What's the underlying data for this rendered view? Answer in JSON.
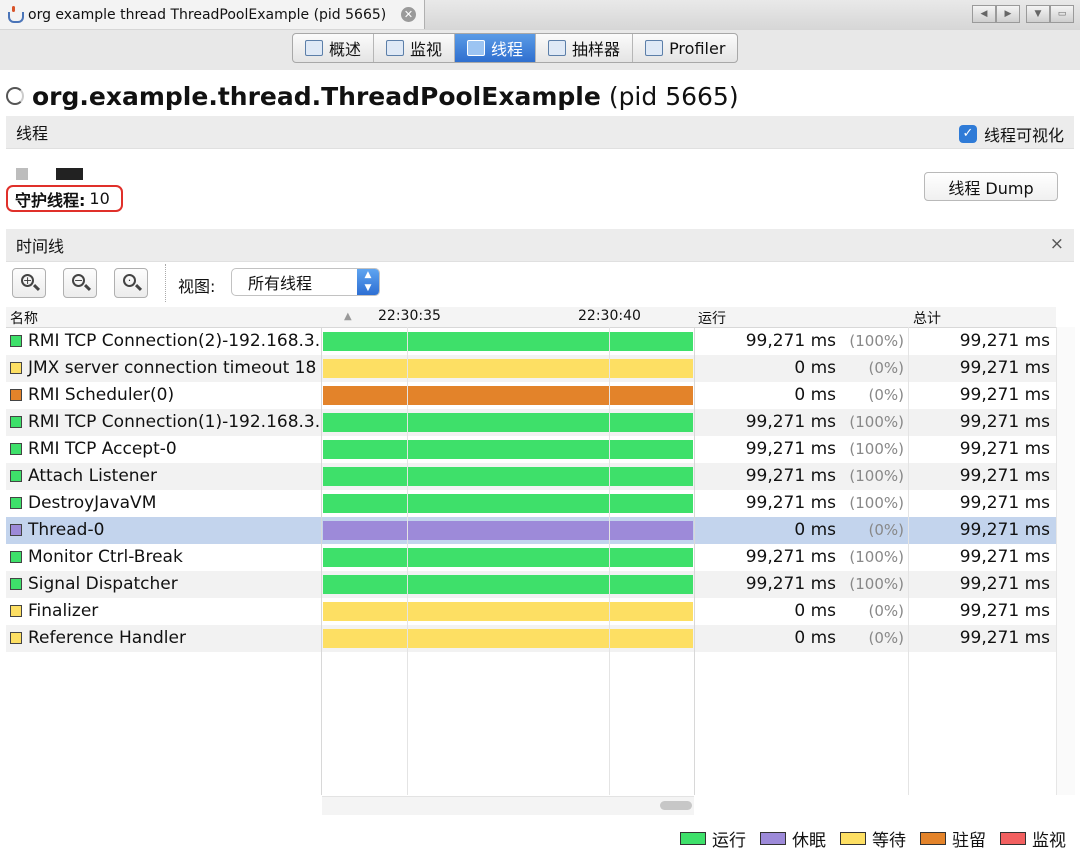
{
  "tab": {
    "title": "org example thread ThreadPoolExample (pid 5665)"
  },
  "views": [
    {
      "label": "概述",
      "icon": "overview-icon"
    },
    {
      "label": "监视",
      "icon": "monitor-icon"
    },
    {
      "label": "线程",
      "icon": "threads-icon",
      "active": true
    },
    {
      "label": "抽样器",
      "icon": "sampler-icon"
    },
    {
      "label": "Profiler",
      "icon": "profiler-icon"
    }
  ],
  "heading": {
    "name": "org.example.thread.ThreadPoolExample",
    "pid": "(pid 5665)"
  },
  "threads_section": {
    "label": "线程",
    "visualize_label": "线程可视化",
    "visualize_checked": true,
    "daemon_label": "守护线程:",
    "daemon_count": "10",
    "dump_button": "线程 Dump"
  },
  "timeline_section": {
    "label": "时间线",
    "close_symbol": "×"
  },
  "toolbar": {
    "view_label": "视图:",
    "view_value": "所有线程"
  },
  "table": {
    "headers": {
      "name": "名称",
      "run": "运行",
      "total": "总计"
    },
    "times": [
      "22:30:35",
      "22:30:40"
    ],
    "rows": [
      {
        "name": "RMI TCP Connection(2)-192.168.3.",
        "state": "running",
        "run": "99,271 ms",
        "pct": "(100%)",
        "total": "99,271 ms"
      },
      {
        "name": "JMX server connection timeout 18",
        "state": "waiting",
        "run": "0 ms",
        "pct": "(0%)",
        "total": "99,271 ms"
      },
      {
        "name": "RMI Scheduler(0)",
        "state": "parked",
        "run": "0 ms",
        "pct": "(0%)",
        "total": "99,271 ms"
      },
      {
        "name": "RMI TCP Connection(1)-192.168.3.",
        "state": "running",
        "run": "99,271 ms",
        "pct": "(100%)",
        "total": "99,271 ms"
      },
      {
        "name": "RMI TCP Accept-0",
        "state": "running",
        "run": "99,271 ms",
        "pct": "(100%)",
        "total": "99,271 ms"
      },
      {
        "name": "Attach Listener",
        "state": "running",
        "run": "99,271 ms",
        "pct": "(100%)",
        "total": "99,271 ms"
      },
      {
        "name": "DestroyJavaVM",
        "state": "running",
        "run": "99,271 ms",
        "pct": "(100%)",
        "total": "99,271 ms"
      },
      {
        "name": "Thread-0",
        "state": "sleeping",
        "run": "0 ms",
        "pct": "(0%)",
        "total": "99,271 ms",
        "selected": true
      },
      {
        "name": "Monitor Ctrl-Break",
        "state": "running",
        "run": "99,271 ms",
        "pct": "(100%)",
        "total": "99,271 ms"
      },
      {
        "name": "Signal Dispatcher",
        "state": "running",
        "run": "99,271 ms",
        "pct": "(100%)",
        "total": "99,271 ms"
      },
      {
        "name": "Finalizer",
        "state": "waiting",
        "run": "0 ms",
        "pct": "(0%)",
        "total": "99,271 ms"
      },
      {
        "name": "Reference Handler",
        "state": "waiting",
        "run": "0 ms",
        "pct": "(0%)",
        "total": "99,271 ms"
      }
    ]
  },
  "legend": [
    {
      "label": "运行",
      "state": "running"
    },
    {
      "label": "休眠",
      "state": "sleeping"
    },
    {
      "label": "等待",
      "state": "waiting"
    },
    {
      "label": "驻留",
      "state": "parked"
    },
    {
      "label": "监视",
      "state": "monitor"
    }
  ],
  "colors": {
    "running": "#3ee06a",
    "sleeping": "#9d8ad9",
    "waiting": "#fddf63",
    "parked": "#e3832a",
    "monitor": "#f26060",
    "accent": "#2f7bd7",
    "highlight_border": "#e0302a"
  }
}
